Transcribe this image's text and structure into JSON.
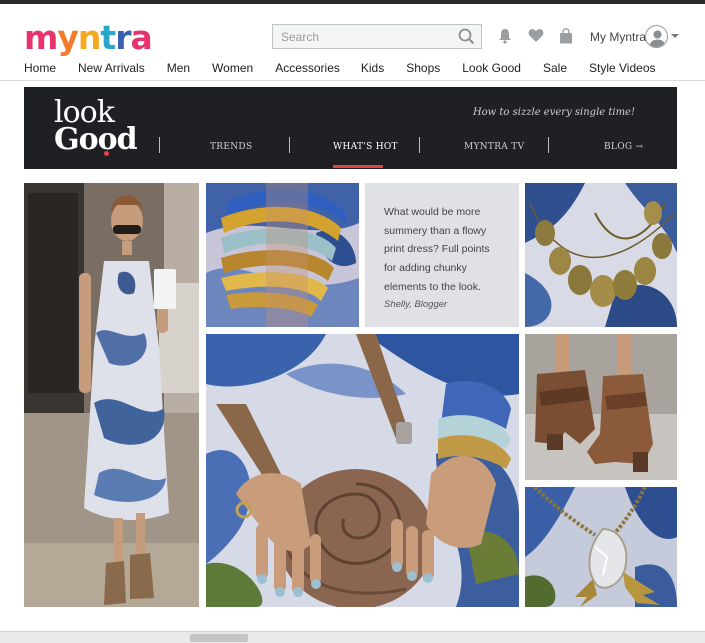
{
  "header": {
    "logo_letters": [
      "m",
      "y",
      "n",
      "t",
      "r",
      "a"
    ],
    "logo_colors": [
      "#e8336f",
      "#f27c2a",
      "#f6a81f",
      "#27a8c8",
      "#3a61b0",
      "#e8336f"
    ],
    "search_placeholder": "Search",
    "icons": [
      "bell-icon",
      "heart-icon",
      "bag-icon",
      "search-icon",
      "avatar-icon",
      "chevron-down-icon"
    ],
    "account_label": "My Myntra"
  },
  "nav": {
    "items": [
      "Home",
      "New Arrivals",
      "Men",
      "Women",
      "Accessories",
      "Kids",
      "Shops",
      "Look Good",
      "Sale",
      "Style Videos"
    ]
  },
  "banner": {
    "logo_top": "look",
    "logo_bottom": "Good",
    "tagline": "How to sizzle every single time!",
    "tabs": [
      {
        "label": "TRENDS"
      },
      {
        "label": "WHAT'S HOT"
      },
      {
        "label": "MYNTRA TV"
      },
      {
        "label": "BLOG"
      }
    ],
    "active_tab": "WHAT'S HOT",
    "accent": "#e8413c",
    "background": "#1f2023"
  },
  "gallery": {
    "quote_text": "What would be more summery than a flowy print dress? Full points for adding chunky elements to the look.",
    "quote_author": "Shelly, Blogger",
    "tiles": [
      {
        "name": "photo-full-look"
      },
      {
        "name": "photo-bracelets"
      },
      {
        "name": "photo-necklace"
      },
      {
        "name": "photo-rose-clutch"
      },
      {
        "name": "photo-ankle-boots"
      },
      {
        "name": "photo-owl-pendant"
      }
    ]
  }
}
